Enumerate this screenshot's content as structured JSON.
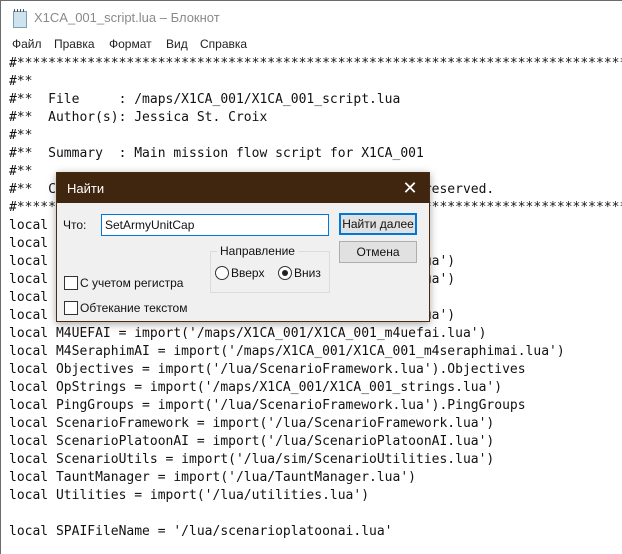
{
  "window": {
    "title": "X1CA_001_script.lua – Блокнот",
    "icon": "notepad-icon"
  },
  "menu": [
    "Файл",
    "Правка",
    "Формат",
    "Вид",
    "Справка"
  ],
  "editor": {
    "lines": [
      "#*******************************************************************************",
      "#**",
      "#**  File     : /maps/X1CA_001/X1CA_001_script.lua",
      "#**  Author(s): Jessica St. Croix",
      "#**",
      "#**  Summary  : Main mission flow script for X1CA_001",
      "#**",
      "#**  C                                         ights reserved.",
      "#*******************************************************************************",
      "local                                       .lua')",
      "local",
      "local                                       orderai.lua')",
      "local                                       orderai.lua')",
      "local                                       fai.lua')",
      "local                                       orderai.lua')",
      "local M4UEFAI = import('/maps/X1CA_001/X1CA_001_m4uefai.lua')",
      "local M4SeraphimAI = import('/maps/X1CA_001/X1CA_001_m4seraphimai.lua')",
      "local Objectives = import('/lua/ScenarioFramework.lua').Objectives",
      "local OpStrings = import('/maps/X1CA_001/X1CA_001_strings.lua')",
      "local PingGroups = import('/lua/ScenarioFramework.lua').PingGroups",
      "local ScenarioFramework = import('/lua/ScenarioFramework.lua')",
      "local ScenarioPlatoonAI = import('/lua/ScenarioPlatoonAI.lua')",
      "local ScenarioUtils = import('/lua/sim/ScenarioUtilities.lua')",
      "local TauntManager = import('/lua/TauntManager.lua')",
      "local Utilities = import('/lua/utilities.lua')",
      "",
      "local SPAIFileName = '/lua/scenarioplatoonai.lua'"
    ]
  },
  "find_dialog": {
    "title": "Найти",
    "close_icon": "close-icon",
    "what_label": "Что:",
    "search_value": "SetArmyUnitCap",
    "find_next_label": "Найти далее",
    "cancel_label": "Отмена",
    "direction_label": "Направление",
    "direction_up": "Вверх",
    "direction_down": "Вниз",
    "direction_selected": "down",
    "match_case_label": "С учетом регистра",
    "match_case_checked": false,
    "wrap_label": "Обтекание текстом",
    "wrap_checked": false
  }
}
